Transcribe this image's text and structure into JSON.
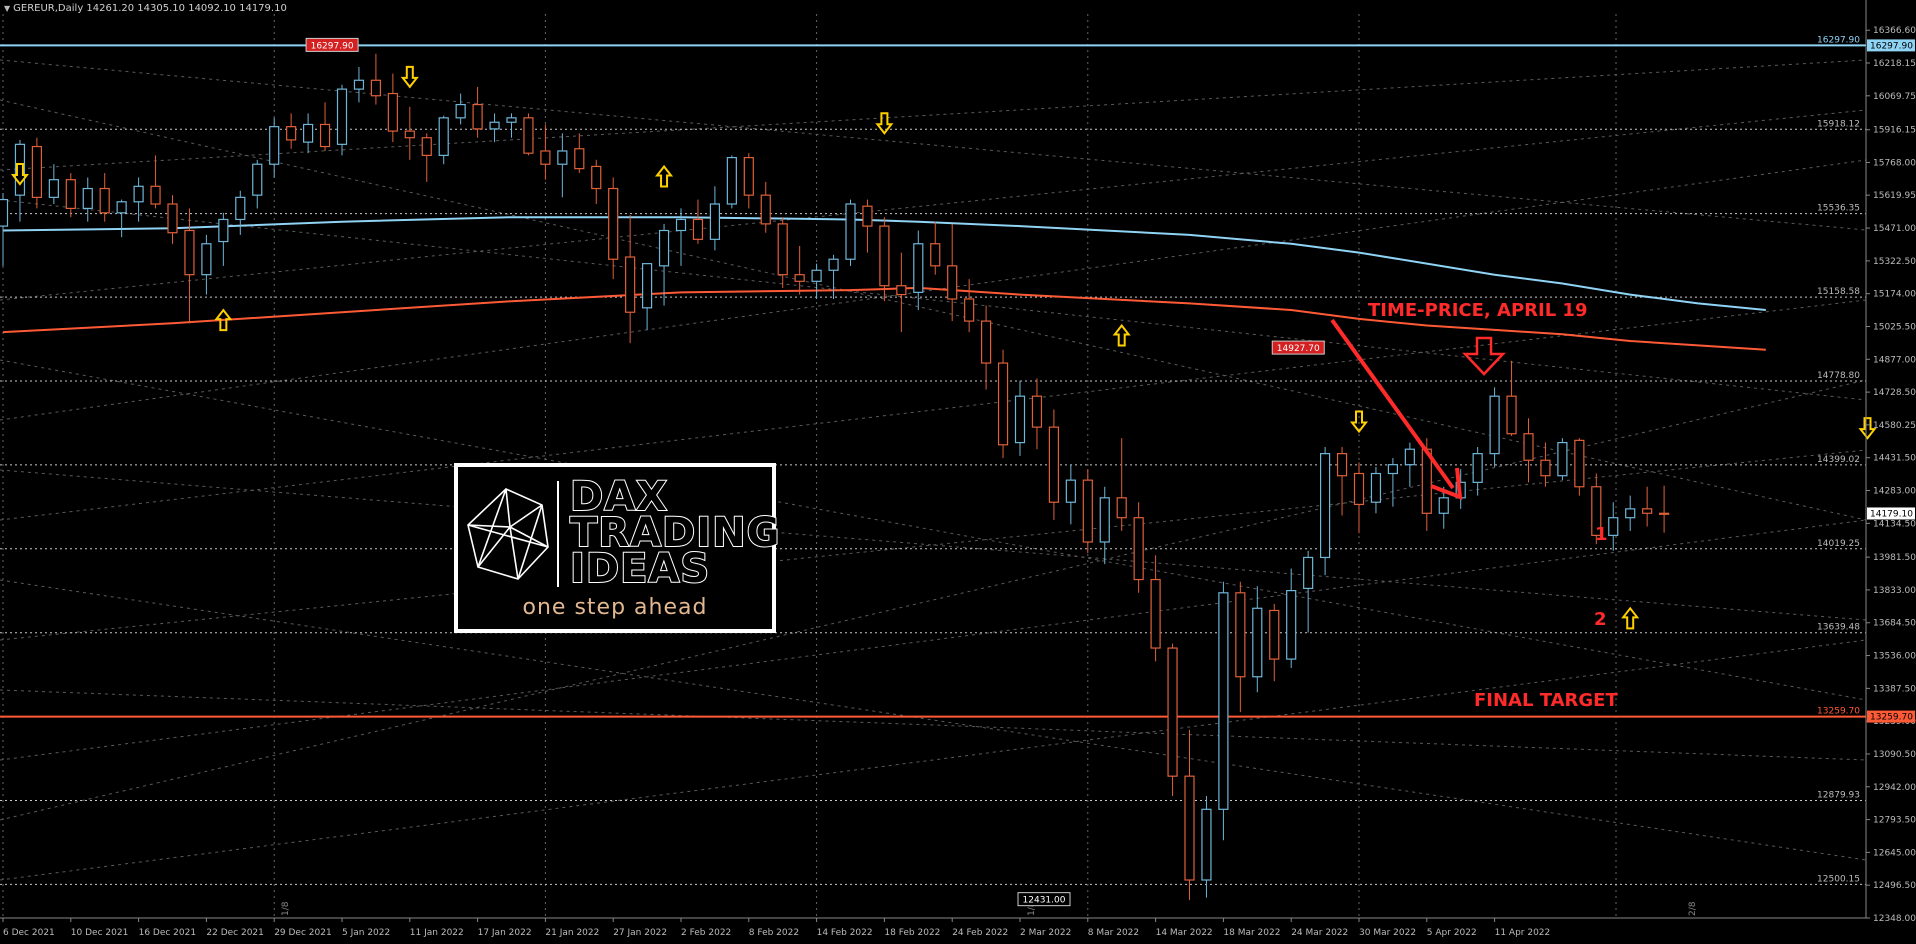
{
  "header": {
    "symbol_line": "GEREUR,Daily  14261.20 14305.10 14092.10 14179.10"
  },
  "colors": {
    "background": "#000000",
    "bull": "#6fb6d9",
    "bear": "#e0603a",
    "ma_fast": "#8fd3f5",
    "ma_slow": "#ff5a36",
    "grid": "#a0a0a0",
    "annotation": "#ff2a2a",
    "arrow_marker": "#ffd000"
  },
  "logo": {
    "word1": "DAX",
    "word2": "TRADING",
    "word3": "IDEAS",
    "tagline": "one step ahead",
    "icon": "icosahedron-icon"
  },
  "annotations": {
    "time_price": "TIME-PRICE, APRIL 19",
    "level_1": "1",
    "level_2": "2",
    "final_target": "FINAL TARGET"
  },
  "chart_data": {
    "type": "candlestick",
    "x_tick_labels": [
      "6 Dec 2021",
      "10 Dec 2021",
      "16 Dec 2021",
      "22 Dec 2021",
      "29 Dec 2021",
      "5 Jan 2022",
      "11 Jan 2022",
      "17 Jan 2022",
      "21 Jan 2022",
      "27 Jan 2022",
      "2 Feb 2022",
      "8 Feb 2022",
      "14 Feb 2022",
      "18 Feb 2022",
      "24 Feb 2022",
      "2 Mar 2022",
      "8 Mar 2022",
      "14 Mar 2022",
      "18 Mar 2022",
      "24 Mar 2022",
      "30 Mar 2022",
      "5 Apr 2022",
      "11 Apr 2022"
    ],
    "x_tick_index": [
      0,
      4,
      8,
      12,
      16,
      20,
      24,
      28,
      32,
      36,
      40,
      44,
      48,
      52,
      56,
      60,
      64,
      68,
      72,
      76,
      80,
      84,
      88
    ],
    "ylim": [
      12348,
      16440
    ],
    "y_tick_labels": [
      16366.6,
      16218.15,
      16069.75,
      15916.15,
      15768.0,
      15619.95,
      15471.0,
      15322.5,
      15174.0,
      15025.5,
      14877.0,
      14728.5,
      14580.25,
      14431.5,
      14283.0,
      14134.5,
      13981.5,
      13833.0,
      13684.5,
      13536.0,
      13387.5,
      13239.0,
      13090.5,
      12942.0,
      12793.5,
      12645.0,
      12496.5,
      12348.0
    ],
    "horizontal_levels": [
      {
        "value": 16297.9,
        "label": "16297.90",
        "color": "#8fd3f5",
        "style": "solid"
      },
      {
        "value": 15918.12,
        "label": "15918.12",
        "color": "#c8c8c8",
        "style": "dotted"
      },
      {
        "value": 15536.35,
        "label": "15536.35",
        "color": "#c8c8c8",
        "style": "dotted"
      },
      {
        "value": 15158.58,
        "label": "15158.58",
        "color": "#c8c8c8",
        "style": "dotted"
      },
      {
        "value": 14778.8,
        "label": "14778.80",
        "color": "#c8c8c8",
        "style": "dotted"
      },
      {
        "value": 14399.02,
        "label": "14399.02",
        "color": "#c8c8c8",
        "style": "dotted"
      },
      {
        "value": 14019.25,
        "label": "14019.25",
        "color": "#c8c8c8",
        "style": "dotted"
      },
      {
        "value": 13639.48,
        "label": "13639.48",
        "color": "#c8c8c8",
        "style": "dotted"
      },
      {
        "value": 13259.7,
        "label": "13259.70",
        "color": "#ff5a36",
        "style": "solid"
      },
      {
        "value": 12879.93,
        "label": "12879.93",
        "color": "#c8c8c8",
        "style": "dotted"
      },
      {
        "value": 12500.15,
        "label": "12500.15",
        "color": "#c8c8c8",
        "style": "dotted"
      }
    ],
    "current_price": {
      "value": 14179.1,
      "label": "14179.10"
    },
    "price_labels": [
      {
        "index": 18,
        "value": 16297.9,
        "label": "16297.90",
        "color": "#d42020"
      },
      {
        "index": 75,
        "value": 14927.7,
        "label": "14927.70",
        "color": "#d42020"
      },
      {
        "index": 60,
        "value": 12431.0,
        "label": "12431.00",
        "color": "#000000"
      }
    ],
    "vertical_markers": [
      {
        "index": 17,
        "label": "1/8"
      },
      {
        "index": 61,
        "label": "1/8"
      },
      {
        "index": 100,
        "label": "2/8"
      }
    ],
    "series": [
      {
        "name": "OHLC",
        "ohlc": [
          [
            15480,
            15630,
            15300,
            15600
          ],
          [
            15620,
            15870,
            15500,
            15850
          ],
          [
            15840,
            15880,
            15560,
            15610
          ],
          [
            15610,
            15760,
            15580,
            15690
          ],
          [
            15690,
            15720,
            15520,
            15560
          ],
          [
            15560,
            15700,
            15500,
            15650
          ],
          [
            15650,
            15720,
            15500,
            15540
          ],
          [
            15540,
            15600,
            15430,
            15590
          ],
          [
            15590,
            15700,
            15500,
            15660
          ],
          [
            15660,
            15800,
            15560,
            15580
          ],
          [
            15580,
            15620,
            15400,
            15450
          ],
          [
            15460,
            15560,
            15040,
            15260
          ],
          [
            15260,
            15440,
            15170,
            15400
          ],
          [
            15410,
            15540,
            15300,
            15510
          ],
          [
            15510,
            15640,
            15440,
            15610
          ],
          [
            15620,
            15780,
            15560,
            15760
          ],
          [
            15760,
            15970,
            15700,
            15930
          ],
          [
            15930,
            15990,
            15830,
            15870
          ],
          [
            15860,
            15990,
            15810,
            15940
          ],
          [
            15940,
            16040,
            15820,
            15840
          ],
          [
            15850,
            16120,
            15800,
            16100
          ],
          [
            16100,
            16200,
            16040,
            16140
          ],
          [
            16140,
            16260,
            16030,
            16070
          ],
          [
            16080,
            16170,
            15860,
            15910
          ],
          [
            15910,
            16020,
            15780,
            15880
          ],
          [
            15880,
            15900,
            15680,
            15800
          ],
          [
            15800,
            15980,
            15760,
            15970
          ],
          [
            15970,
            16080,
            15940,
            16030
          ],
          [
            16030,
            16110,
            15880,
            15920
          ],
          [
            15920,
            15990,
            15860,
            15950
          ],
          [
            15950,
            15990,
            15880,
            15970
          ],
          [
            15970,
            15990,
            15800,
            15810
          ],
          [
            15820,
            15940,
            15690,
            15760
          ],
          [
            15760,
            15900,
            15610,
            15820
          ],
          [
            15830,
            15900,
            15720,
            15740
          ],
          [
            15750,
            15780,
            15580,
            15650
          ],
          [
            15650,
            15700,
            15240,
            15330
          ],
          [
            15340,
            15530,
            14950,
            15090
          ],
          [
            15110,
            15290,
            15010,
            15310
          ],
          [
            15300,
            15490,
            15120,
            15460
          ],
          [
            15460,
            15560,
            15300,
            15510
          ],
          [
            15510,
            15600,
            15400,
            15420
          ],
          [
            15420,
            15660,
            15370,
            15580
          ],
          [
            15580,
            15800,
            15560,
            15790
          ],
          [
            15790,
            15810,
            15560,
            15620
          ],
          [
            15620,
            15680,
            15450,
            15490
          ],
          [
            15490,
            15520,
            15200,
            15260
          ],
          [
            15260,
            15390,
            15170,
            15230
          ],
          [
            15230,
            15310,
            15150,
            15280
          ],
          [
            15280,
            15350,
            15150,
            15330
          ],
          [
            15330,
            15600,
            15300,
            15580
          ],
          [
            15570,
            15600,
            15360,
            15480
          ],
          [
            15480,
            15520,
            15140,
            15210
          ],
          [
            15210,
            15360,
            15000,
            15170
          ],
          [
            15180,
            15460,
            15100,
            15400
          ],
          [
            15400,
            15500,
            15260,
            15300
          ],
          [
            15300,
            15490,
            15050,
            15150
          ],
          [
            15150,
            15240,
            15000,
            15050
          ],
          [
            15050,
            15120,
            14740,
            14860
          ],
          [
            14860,
            14920,
            14430,
            14490
          ],
          [
            14500,
            14780,
            14440,
            14710
          ],
          [
            14710,
            14790,
            14470,
            14570
          ],
          [
            14570,
            14650,
            14150,
            14230
          ],
          [
            14230,
            14400,
            14130,
            14330
          ],
          [
            14330,
            14380,
            14000,
            14050
          ],
          [
            14050,
            14300,
            13950,
            14250
          ],
          [
            14250,
            14520,
            14100,
            14160
          ],
          [
            14160,
            14230,
            13820,
            13880
          ],
          [
            13880,
            13990,
            13510,
            13570
          ],
          [
            13570,
            13590,
            12900,
            12990
          ],
          [
            12990,
            13200,
            12430,
            12520
          ],
          [
            12520,
            12900,
            12440,
            12840
          ],
          [
            12840,
            13870,
            12700,
            13820
          ],
          [
            13820,
            13870,
            13280,
            13440
          ],
          [
            13440,
            13850,
            13370,
            13750
          ],
          [
            13740,
            13770,
            13420,
            13520
          ],
          [
            13520,
            13930,
            13480,
            13830
          ],
          [
            13840,
            14010,
            13640,
            13980
          ],
          [
            13980,
            14480,
            13900,
            14450
          ],
          [
            14450,
            14480,
            14170,
            14350
          ],
          [
            14360,
            14410,
            14090,
            14220
          ],
          [
            14230,
            14390,
            14180,
            14360
          ],
          [
            14360,
            14430,
            14210,
            14400
          ],
          [
            14400,
            14500,
            14300,
            14470
          ],
          [
            14470,
            14520,
            14100,
            14180
          ],
          [
            14180,
            14300,
            14110,
            14250
          ],
          [
            14250,
            14380,
            14200,
            14320
          ],
          [
            14320,
            14480,
            14260,
            14450
          ],
          [
            14450,
            14750,
            14390,
            14710
          ],
          [
            14710,
            14870,
            14530,
            14540
          ],
          [
            14540,
            14610,
            14320,
            14420
          ],
          [
            14420,
            14500,
            14300,
            14350
          ],
          [
            14350,
            14520,
            14330,
            14500
          ],
          [
            14510,
            14520,
            14260,
            14300
          ],
          [
            14300,
            14360,
            14040,
            14080
          ],
          [
            14080,
            14230,
            14010,
            14160
          ],
          [
            14160,
            14260,
            14100,
            14200
          ],
          [
            14200,
            14300,
            14120,
            14180
          ],
          [
            14180,
            14305,
            14092,
            14179
          ]
        ]
      },
      {
        "name": "MA fast",
        "x": [
          0,
          10,
          20,
          30,
          40,
          50,
          54,
          60,
          70,
          76,
          80,
          84,
          88,
          92,
          96,
          100,
          104
        ],
        "y": [
          15460,
          15470,
          15500,
          15520,
          15520,
          15510,
          15500,
          15480,
          15440,
          15400,
          15360,
          15310,
          15260,
          15220,
          15170,
          15130,
          15100
        ]
      },
      {
        "name": "MA slow",
        "x": [
          0,
          10,
          20,
          30,
          40,
          50,
          54,
          60,
          70,
          76,
          80,
          84,
          88,
          92,
          96,
          100,
          104
        ],
        "y": [
          15000,
          15040,
          15090,
          15140,
          15180,
          15190,
          15200,
          15170,
          15130,
          15100,
          15060,
          15030,
          15010,
          14990,
          14960,
          14940,
          14920
        ]
      }
    ],
    "arrow_markers": [
      {
        "index": 1,
        "dir": "down",
        "value": 15720
      },
      {
        "index": 13,
        "dir": "up",
        "value": 15050
      },
      {
        "index": 24,
        "dir": "down",
        "value": 16160
      },
      {
        "index": 39,
        "dir": "up",
        "value": 15700
      },
      {
        "index": 52,
        "dir": "down",
        "value": 15950
      },
      {
        "index": 66,
        "dir": "up",
        "value": 14980
      },
      {
        "index": 80,
        "dir": "down",
        "value": 14600
      },
      {
        "index": 96,
        "dir": "up",
        "value": 13700
      },
      {
        "index": 110,
        "dir": "down",
        "value": 14570
      }
    ],
    "grid": true
  }
}
